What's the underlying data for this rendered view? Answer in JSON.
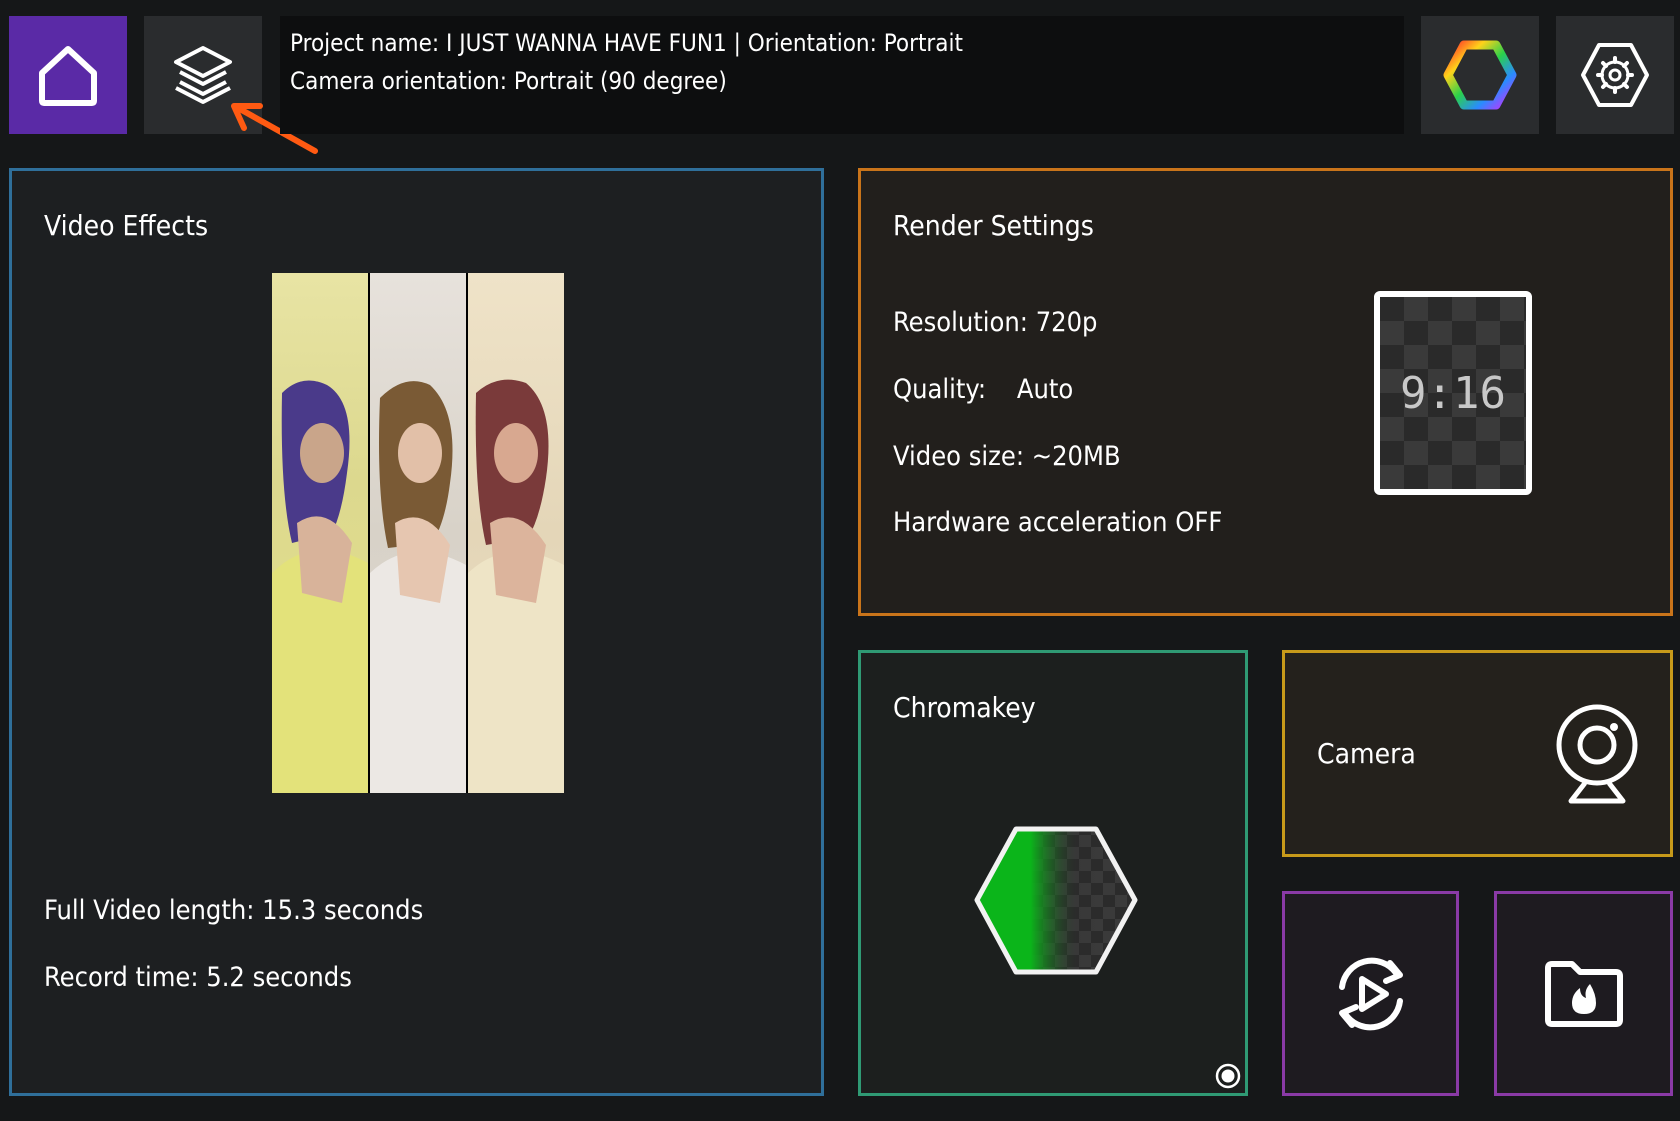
{
  "topbar": {
    "info_line1": "Project name: I JUST WANNA HAVE FUN1 | Orientation: Portrait",
    "info_line2": "Camera orientation: Portrait (90 degree)",
    "icons": [
      "home-icon",
      "layers-icon",
      "color-hexagon-icon",
      "settings-gear-icon"
    ]
  },
  "video_effects": {
    "title": "Video Effects",
    "full_length": "Full Video length: 15.3 seconds",
    "record_time": "Record time:  5.2 seconds"
  },
  "render_settings": {
    "title": "Render Settings",
    "resolution": "Resolution: 720p",
    "quality": "Quality:    Auto",
    "video_size": "Video size: ~20MB",
    "hw_accel": "Hardware acceleration OFF",
    "aspect_ratio": "9:16"
  },
  "chromakey": {
    "title": "Chromakey"
  },
  "camera": {
    "title": "Camera"
  },
  "colors": {
    "home_bg": "#5a2aa6",
    "video_effects_border": "#2f6f9a",
    "render_border": "#c9741a",
    "chromakey_border": "#2f9a74",
    "camera_border": "#c79a1a",
    "action_border": "#8a3aa6",
    "arrow": "#ff5a12"
  }
}
